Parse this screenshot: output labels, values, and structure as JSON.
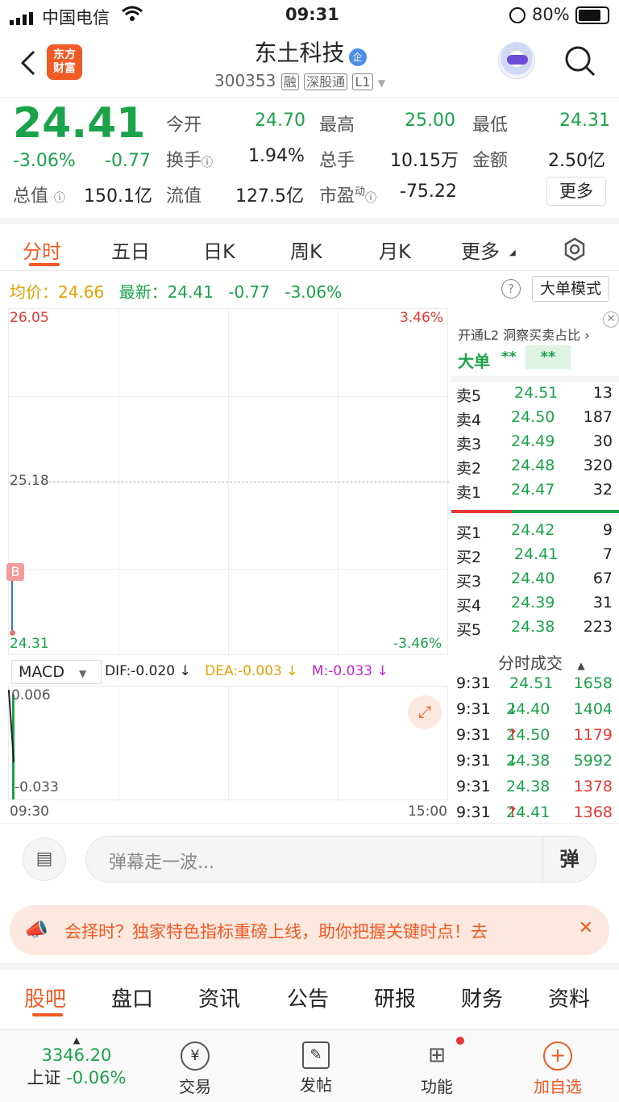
{
  "status": {
    "carrier": "中国电信",
    "time": "09:31",
    "battery": "80%"
  },
  "header": {
    "logo": "东方\n财富",
    "title": "东土科技",
    "title_badge": "企",
    "code": "300353",
    "tags": [
      "融",
      "深股通",
      "L1"
    ]
  },
  "quote": {
    "price": "24.41",
    "change_pct": "-3.06%",
    "change": "-0.77",
    "fields": [
      {
        "label": "今开",
        "value": "24.70"
      },
      {
        "label": "最高",
        "value": "25.00"
      },
      {
        "label": "最低",
        "value": "24.31"
      },
      {
        "label": "换手",
        "value": "1.94%"
      },
      {
        "label": "总手",
        "value": "10.15万"
      },
      {
        "label": "金额",
        "value": "2.50亿"
      },
      {
        "label": "总值",
        "value": "150.1亿"
      },
      {
        "label": "流值",
        "value": "127.5亿"
      },
      {
        "label": "市盈",
        "sup": "动",
        "value": "-75.22"
      }
    ],
    "more_button": "更多"
  },
  "tabs": [
    "分时",
    "五日",
    "日K",
    "周K",
    "月K",
    "更多"
  ],
  "chart_info": {
    "avg_label": "均价：",
    "avg_value": "24.66",
    "latest_label": "最新：",
    "latest_value": "24.41",
    "latest_change": "-0.77",
    "latest_pct": "-3.06%",
    "mode_button": "大单模式"
  },
  "chart": {
    "y_top": "26.05",
    "y_mid": "25.18",
    "y_bottom": "24.31",
    "pct_top": "3.46%",
    "pct_bottom": "-3.46%",
    "marker": "B",
    "x_start": "09:30",
    "x_end": "15:00"
  },
  "macd": {
    "selector": "MACD",
    "dif": "DIF:-0.020 ↓",
    "dea": "DEA:-0.003 ↓",
    "m": "M:-0.033 ↓",
    "y_top": "0.006",
    "y_bottom": "-0.033"
  },
  "orderbook": {
    "l2_promo": "开通L2 洞察买卖占比",
    "big_order_label": "大单",
    "big_order_v1": "**",
    "big_order_v2": "**",
    "asks": [
      {
        "label": "卖5",
        "price": "24.51",
        "vol": "13"
      },
      {
        "label": "卖4",
        "price": "24.50",
        "vol": "187"
      },
      {
        "label": "卖3",
        "price": "24.49",
        "vol": "30"
      },
      {
        "label": "卖2",
        "price": "24.48",
        "vol": "320"
      },
      {
        "label": "卖1",
        "price": "24.47",
        "vol": "32"
      }
    ],
    "bids": [
      {
        "label": "买1",
        "price": "24.42",
        "vol": "9"
      },
      {
        "label": "买2",
        "price": "24.41",
        "vol": "7"
      },
      {
        "label": "买3",
        "price": "24.40",
        "vol": "67"
      },
      {
        "label": "买4",
        "price": "24.39",
        "vol": "31"
      },
      {
        "label": "买5",
        "price": "24.38",
        "vol": "223"
      }
    ],
    "trades_title": "分时成交",
    "trades": [
      {
        "time": "9:31",
        "price": "24.51",
        "arrow": "",
        "vol": "1658",
        "volcolor": "#1aa34a"
      },
      {
        "time": "9:31",
        "price": "24.40",
        "arrow": "↓",
        "vol": "1404",
        "volcolor": "#1aa34a"
      },
      {
        "time": "9:31",
        "price": "24.50",
        "arrow": "↑",
        "vol": "1179",
        "volcolor": "#e53935"
      },
      {
        "time": "9:31",
        "price": "24.38",
        "arrow": "↓",
        "vol": "5992",
        "volcolor": "#1aa34a"
      },
      {
        "time": "9:31",
        "price": "24.38",
        "arrow": "",
        "vol": "1378",
        "volcolor": "#e53935"
      },
      {
        "time": "9:31",
        "price": "24.41",
        "arrow": "↑",
        "vol": "1368",
        "volcolor": "#e53935"
      }
    ]
  },
  "comment": {
    "placeholder": "弹幕走一波...",
    "send": "弹"
  },
  "banner": {
    "text": "会择时？独家特色指标重磅上线，助你把握关键时点！去"
  },
  "section_tabs": [
    "股吧",
    "盘口",
    "资讯",
    "公告",
    "研报",
    "财务",
    "资料"
  ],
  "bottom": {
    "index_value": "3346.20",
    "index_name": "上证",
    "index_change": "-0.06%",
    "items": [
      "交易",
      "发帖",
      "功能",
      "加自选"
    ]
  },
  "colors": {
    "up": "#e53935",
    "down": "#1aa34a",
    "accent": "#f05a24"
  }
}
